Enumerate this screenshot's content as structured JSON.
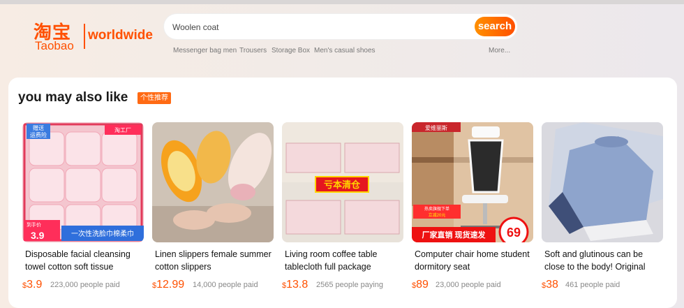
{
  "brand": {
    "cn": "淘宝",
    "en": "Taobao",
    "worldwide": "worldwide",
    "color": "#ff5000"
  },
  "search": {
    "value": "Woolen coat",
    "button_label": "search"
  },
  "hot_searches": [
    "Messenger bag men",
    "Trousers",
    "Storage Box",
    "Men's casual shoes"
  ],
  "more_label": "More...",
  "section": {
    "title": "you may also like",
    "tag": "个性推荐"
  },
  "products": [
    {
      "title": "Disposable facial cleansing towel cotton soft tissue",
      "currency": "$",
      "price": "3.9",
      "paid": "223,000 people paid",
      "badges": [
        "赠送",
        "运费险",
        "淘工厂",
        "到手价",
        "3.9",
        "一次性洗脸巾棉柔巾"
      ]
    },
    {
      "title": "Linen slippers female summer cotton slippers",
      "currency": "$",
      "price": "12.99",
      "paid": "14,000 people paid"
    },
    {
      "title": "Living room coffee table tablecloth full package",
      "currency": "$",
      "price": "13.8",
      "paid": "2565 people paying",
      "badges": [
        "亏本清仓"
      ]
    },
    {
      "title": "Computer chair home student dormitory seat",
      "currency": "$",
      "price": "89",
      "paid": "23,000 people paid",
      "badges": [
        "爱维丽斯",
        "热卖旗舰下单",
        "立减20元",
        "厂家直销 现货速发",
        "69"
      ]
    },
    {
      "title": "Soft and glutinous can be close to the body! Original",
      "currency": "$",
      "price": "38",
      "paid": "461 people paid"
    }
  ]
}
